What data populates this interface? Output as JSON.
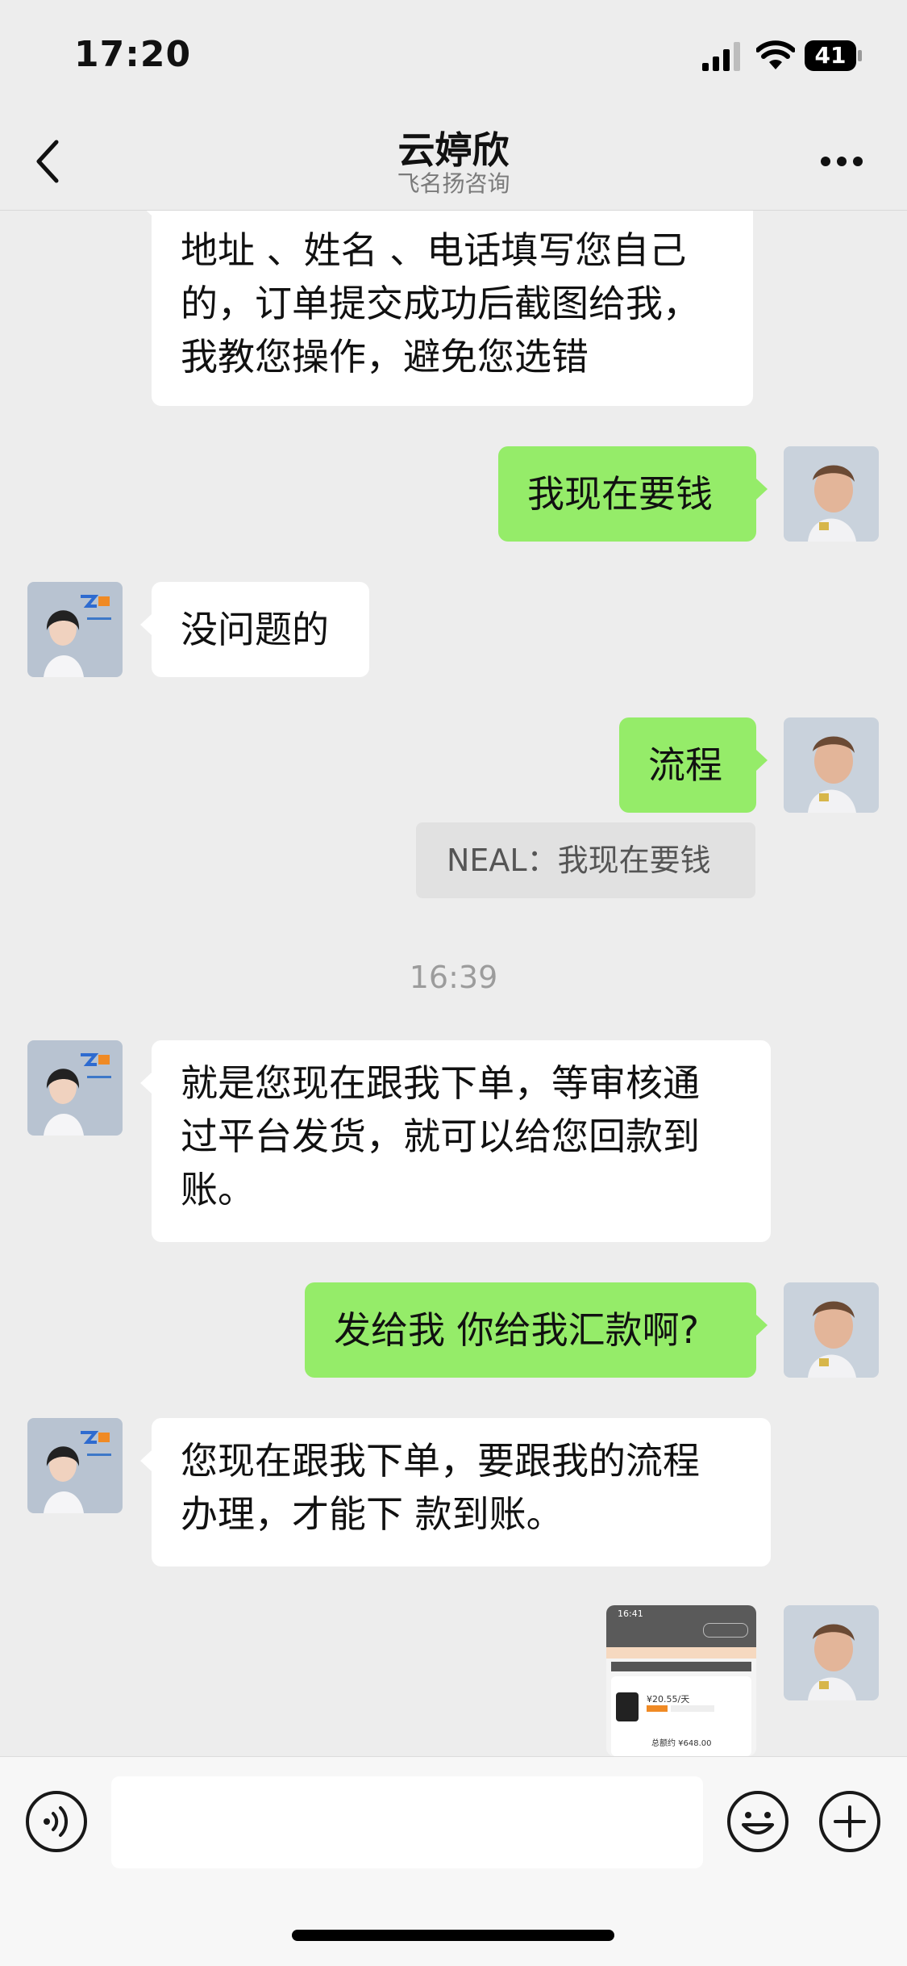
{
  "status_bar": {
    "time": "17:20",
    "battery": "41"
  },
  "header": {
    "title": "云婷欣",
    "subtitle": "飞名扬咨询"
  },
  "messages": [
    {
      "side": "in",
      "lines": [
        "地址 、姓名 、电话填写您自己",
        "的，订单提交成功后截图给我，",
        "我教您操作，避免您选错"
      ]
    },
    {
      "side": "out",
      "text": "我现在要钱"
    },
    {
      "side": "in",
      "text": "没问题的"
    },
    {
      "side": "out",
      "text": "流程"
    },
    {
      "side": "out",
      "quote": "NEAL：我现在要钱"
    },
    {
      "timestamp": "16:39"
    },
    {
      "side": "in",
      "lines": [
        "就是您现在跟我下单，等审核通",
        "过平台发货，就可以给您回款到",
        "账。"
      ]
    },
    {
      "side": "out",
      "text": "发给我 你给我汇款啊?"
    },
    {
      "side": "in",
      "lines": [
        "您现在跟我下单，要跟我的流程",
        "办理，才能下 款到账。"
      ]
    },
    {
      "side": "out",
      "image": {
        "time": "16:41",
        "price": "¥20.55/天",
        "total": "总额约 ¥648.00"
      }
    }
  ],
  "input_bar": {
    "placeholder": ""
  },
  "icons": {
    "back": "chevron-left-icon",
    "more": "more-icon",
    "voice": "voice-icon",
    "emoji": "emoji-icon",
    "plus": "plus-icon"
  },
  "colors": {
    "outgoing_bubble": "#95ec69",
    "incoming_bubble": "#ffffff",
    "background": "#ededed"
  }
}
